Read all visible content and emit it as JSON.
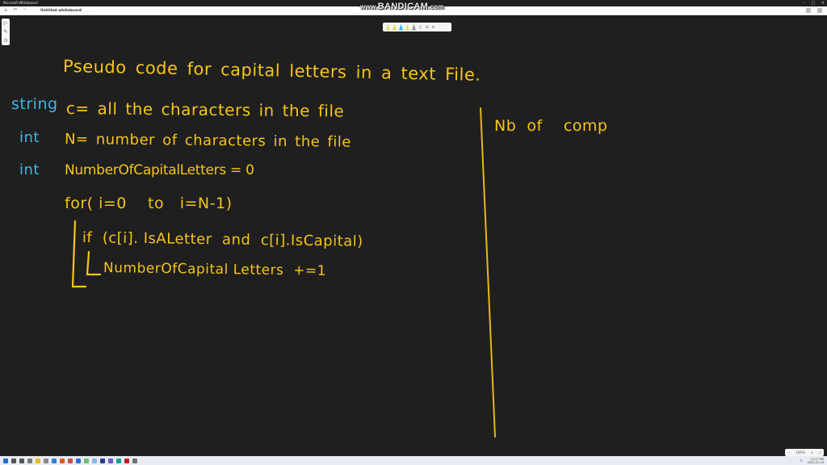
{
  "window": {
    "title": "Microsoft Whiteboard",
    "controls": [
      "minimize",
      "maximize",
      "close"
    ]
  },
  "appbar": {
    "home_icon": "home-icon",
    "undo_icon": "undo-icon",
    "redo_icon": "redo-icon",
    "board_title": "Untitled whiteboard",
    "title_chevron": "⌄"
  },
  "watermark": {
    "prefix": "www.",
    "brand": "BANDICAM",
    "suffix": ".com"
  },
  "pen_toolbar": {
    "pens": [
      {
        "name": "pen-yellow-green",
        "color": "#d9e36b"
      },
      {
        "name": "pen-yellow",
        "color": "#e8d84a"
      },
      {
        "name": "pen-blue",
        "color": "#3fb7e6"
      },
      {
        "name": "pen-light-yellow",
        "color": "#f0e060"
      },
      {
        "name": "pen-gray",
        "color": "#9a9a9a"
      }
    ],
    "eraser_icon": "▯",
    "lasso_icon": "⟲",
    "close_icon": "×"
  },
  "left_tools": {
    "select_icon": "▷",
    "pen_icon": "✎",
    "more_icon": "⊙"
  },
  "whiteboard": {
    "ink_color": "#f5c518",
    "type_color": "#3fb7e6",
    "title_line": "Pseudo  code  for capital letters in a text  File.",
    "lines": [
      {
        "type": "string",
        "code": "c= all  the  characters  in the file"
      },
      {
        "type": "int",
        "code": "N= number  of characters  in  the  file"
      },
      {
        "type": "int",
        "code": "NumberOfCapitalLetters = 0"
      }
    ],
    "loop_line": "for( i=0    to   i=N-1)",
    "if_line": "if  (c[i]. IsALetter  and  c[i].IsCapital)",
    "body_line": "NumberOfCapital Letters  +=1",
    "right_note": "Nb  of    comp"
  },
  "zoombar": {
    "zoom_out": "−",
    "zoom_level": "100%",
    "zoom_in": "+",
    "fit_icon": "⤢"
  },
  "taskbar": {
    "apps": [
      {
        "name": "start",
        "color": "#1f6fd1"
      },
      {
        "name": "search",
        "color": "#555555"
      },
      {
        "name": "task-view",
        "color": "#555555"
      },
      {
        "name": "widgets",
        "color": "#7a7a7a"
      },
      {
        "name": "file-explorer",
        "color": "#e8b820"
      },
      {
        "name": "app-gray",
        "color": "#8a8a8a"
      },
      {
        "name": "edge",
        "color": "#2a7fd4"
      },
      {
        "name": "app-orange",
        "color": "#e05a2a"
      },
      {
        "name": "app-multicolor",
        "color": "#d04a4a"
      },
      {
        "name": "app-blue",
        "color": "#2a6fd4"
      },
      {
        "name": "app-green",
        "color": "#6bc26b"
      },
      {
        "name": "app-lightblue",
        "color": "#8ab8e8"
      },
      {
        "name": "app-navy",
        "color": "#2a3a8a"
      },
      {
        "name": "app-purple",
        "color": "#6a5ad4"
      },
      {
        "name": "app-teal",
        "color": "#1aa0a0"
      },
      {
        "name": "app-red",
        "color": "#c0202a"
      },
      {
        "name": "settings",
        "color": "#707070"
      }
    ],
    "tray": {
      "pen_icon": "✎",
      "time": "12:37 PM",
      "date": "2022-01-19"
    }
  }
}
